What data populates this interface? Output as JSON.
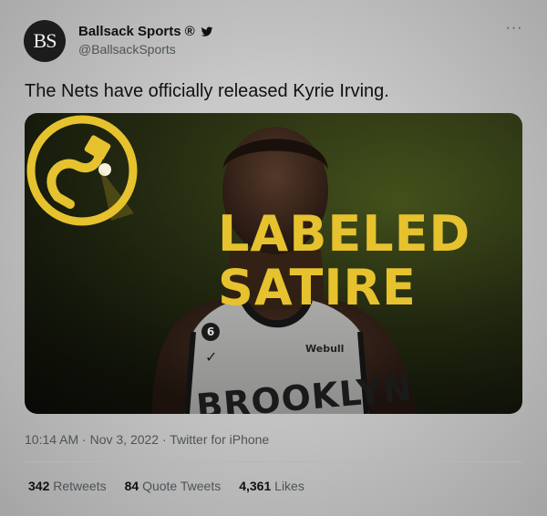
{
  "account": {
    "avatar_text": "BS",
    "display_name": "Ballsack Sports",
    "registered_mark": "®",
    "handle": "@BallsackSports"
  },
  "tweet": {
    "text": "The Nets have officially released Kyrie Irving.",
    "timestamp": "10:14 AM · Nov 3, 2022 · Twitter for iPhone"
  },
  "media": {
    "badge_line1": "LABELED",
    "badge_line2": "SATIRE",
    "jersey_number": "6",
    "jersey_brand": "Webull",
    "jersey_team": "BROOKLYN",
    "accent_color": "#e6c22e"
  },
  "stats": [
    {
      "count": "342",
      "label": "Retweets"
    },
    {
      "count": "84",
      "label": "Quote Tweets"
    },
    {
      "count": "4,361",
      "label": "Likes"
    }
  ],
  "icons": {
    "verified": "twitter-bird-icon",
    "more": "more-options-icon"
  }
}
